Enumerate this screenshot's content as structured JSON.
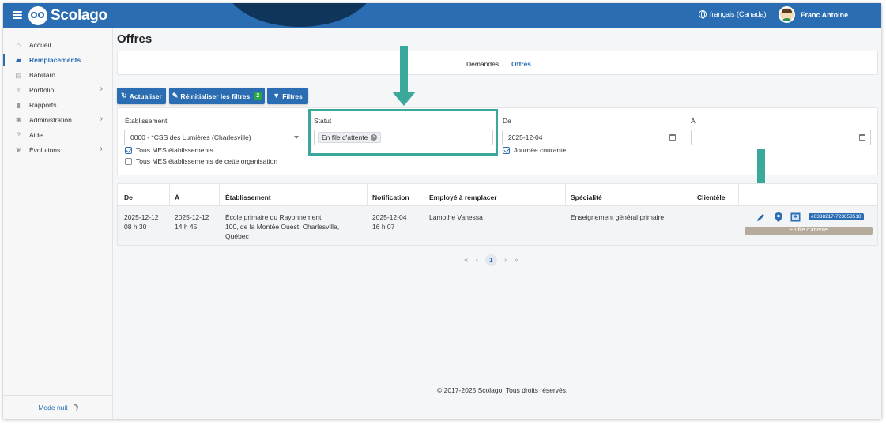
{
  "brand": {
    "name": "Scolago"
  },
  "header": {
    "language": "français (Canada)",
    "user_name": "Franc Antoine"
  },
  "sidebar": {
    "items": [
      {
        "label": "Accueil",
        "icon": "home-icon",
        "active": false,
        "has_submenu": false
      },
      {
        "label": "Remplacements",
        "icon": "map-icon",
        "active": true,
        "has_submenu": false
      },
      {
        "label": "Babillard",
        "icon": "board-icon",
        "active": false,
        "has_submenu": false
      },
      {
        "label": "Portfolio",
        "icon": "trophy-icon",
        "active": false,
        "has_submenu": true
      },
      {
        "label": "Rapports",
        "icon": "report-icon",
        "active": false,
        "has_submenu": false
      },
      {
        "label": "Administration",
        "icon": "gear-icon",
        "active": false,
        "has_submenu": true
      },
      {
        "label": "Aide",
        "icon": "help-icon",
        "active": false,
        "has_submenu": false
      },
      {
        "label": "Évolutions",
        "icon": "evolution-icon",
        "active": false,
        "has_submenu": true
      }
    ],
    "night_mode_label": "Mode nuit"
  },
  "page": {
    "title": "Offres"
  },
  "tabs": [
    {
      "label": "Demandes",
      "active": false
    },
    {
      "label": "Offres",
      "active": true
    }
  ],
  "toolbar": {
    "refresh_label": "Actualiser",
    "reset_filters_label": "Réinitialiser les filtres",
    "reset_filters_count": "2",
    "filters_label": "Filtres"
  },
  "filters": {
    "etablissement_label": "Établissement",
    "etablissement_value": "0000 - *CSS des Lumières (Charlesville)",
    "tous_mes_etab": "Tous MES établissements",
    "tous_mes_etab_org": "Tous MES établissements de cette organisation",
    "statut_label": "Statut",
    "statut_chip": "En file d'attente",
    "de_label": "De",
    "de_value": "2025-12-04",
    "journee_courante": "Journée courante",
    "a_label": "À",
    "a_value": ""
  },
  "table": {
    "headers": [
      "De",
      "À",
      "Établissement",
      "Notification",
      "Employé à remplacer",
      "Spécialité",
      "Clientèle"
    ],
    "rows": [
      {
        "de_date": "2025-12-12",
        "de_time": "08 h 30",
        "a_date": "2025-12-12",
        "a_time": "14 h 45",
        "etab_line1": "École primaire du Rayonnement",
        "etab_line2": "100, de la Montée Ouest, Charlesville,",
        "etab_line3": "Québec",
        "notif_date": "2025-12-04",
        "notif_time": "16 h 07",
        "employe": "Lamothe Vanessa",
        "specialite": "Enseignement général primaire",
        "clientele": "",
        "id": "#6338217-723053518",
        "status": "En file d'attente"
      }
    ]
  },
  "pagination": {
    "current": "1"
  },
  "footer": {
    "text": "© 2017-2025 Scolago. Tous droits réservés."
  },
  "colors": {
    "primary": "#2a6db3",
    "highlight": "#3aa99b",
    "badge_green": "#28a745",
    "status_pill": "#b6aa9a"
  }
}
